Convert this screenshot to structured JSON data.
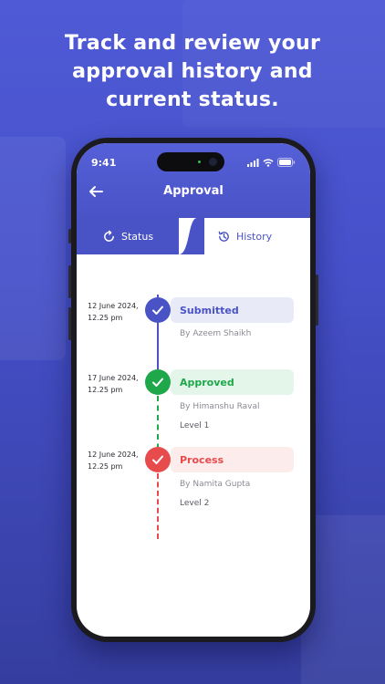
{
  "headline": "Track and review your approval history and current status.",
  "status_bar": {
    "time": "9:41"
  },
  "header": {
    "title": "Approval"
  },
  "tabs": [
    {
      "label": "Status",
      "icon": "refresh-icon",
      "active": true
    },
    {
      "label": "History",
      "icon": "history-icon",
      "active": false
    }
  ],
  "timeline": [
    {
      "date": "12 June 2024,",
      "time": "12.25 pm",
      "status": "Submitted",
      "by": "By Azeem Shaikh",
      "level": "",
      "color": "#4a53c6",
      "bg": "#e9eaf8"
    },
    {
      "date": "17 June 2024,",
      "time": "12.25 pm",
      "status": "Approved",
      "by": "By Himanshu Raval",
      "level": "Level 1",
      "color": "#1ea84a",
      "bg": "#e4f5ea"
    },
    {
      "date": "12 June 2024,",
      "time": "12.25 pm",
      "status": "Process",
      "by": "By Namita Gupta",
      "level": "Level 2",
      "color": "#e84b4b",
      "bg": "#fdecec"
    }
  ],
  "colors": {
    "accent": "#4a53c6",
    "success": "#1ea84a",
    "danger": "#e84b4b"
  }
}
